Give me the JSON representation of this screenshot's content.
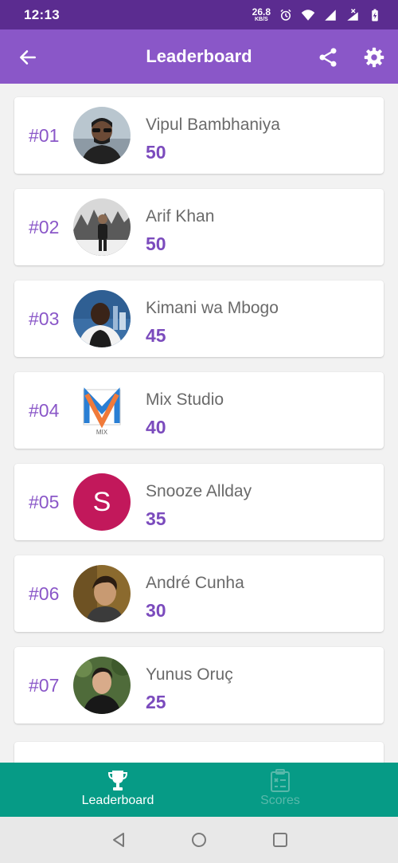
{
  "status_bar": {
    "time": "12:13",
    "net_speed": "26.8",
    "net_unit": "KB/S"
  },
  "app_bar": {
    "title": "Leaderboard",
    "back_icon": "arrow-left-icon",
    "share_icon": "share-icon",
    "settings_icon": "gear-icon"
  },
  "leaderboard": [
    {
      "rank": "#01",
      "name": "Vipul Bambhaniya",
      "score": "50"
    },
    {
      "rank": "#02",
      "name": "Arif Khan",
      "score": "50"
    },
    {
      "rank": "#03",
      "name": "Kimani wa Mbogo",
      "score": "45"
    },
    {
      "rank": "#04",
      "name": "Mix Studio",
      "score": "40",
      "logo_text": "MIX"
    },
    {
      "rank": "#05",
      "name": "Snooze Allday",
      "score": "35",
      "avatar_letter": "S",
      "avatar_color": "#c2185b"
    },
    {
      "rank": "#06",
      "name": "André Cunha",
      "score": "30"
    },
    {
      "rank": "#07",
      "name": "Yunus Oruç",
      "score": "25"
    }
  ],
  "bottom_nav": {
    "items": [
      {
        "label": "Leaderboard",
        "icon": "trophy-icon",
        "active": true
      },
      {
        "label": "Scores",
        "icon": "scoreboard-icon",
        "active": false
      }
    ]
  },
  "colors": {
    "status_bar": "#5b2c90",
    "app_bar": "#8a57c8",
    "accent": "#7b4bbd",
    "bottom_nav": "#069b86"
  }
}
